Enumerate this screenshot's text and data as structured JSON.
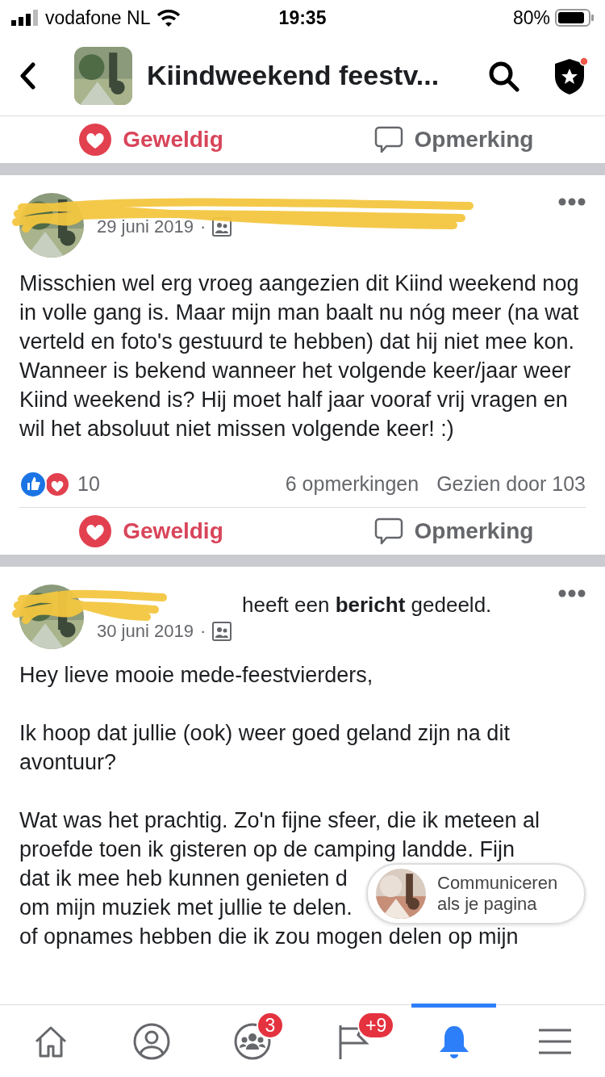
{
  "status_bar": {
    "carrier": "vodafone NL",
    "time": "19:35",
    "battery": "80%"
  },
  "header": {
    "title": "Kiindweekend feestv..."
  },
  "top_actions": [
    {
      "kind": "love",
      "label": "Geweldig"
    },
    {
      "kind": "comment",
      "label": "Opmerking"
    }
  ],
  "posts": [
    {
      "date": "29 juni 2019",
      "separator": "·",
      "paragraphs": [
        "Misschien wel erg vroeg aangezien dit Kiind weekend nog in volle gang is. Maar mijn man baalt nu nóg meer (na wat verteld en foto's gestuurd te hebben) dat hij niet mee kon. Wanneer is bekend wanneer het volgende keer/jaar weer Kiind weekend is? Hij moet half jaar vooraf vrij vragen en wil het absoluut niet missen volgende keer! :)"
      ],
      "reactions": {
        "count": "10",
        "comments": "6 opmerkingen",
        "views": "Gezien door 103"
      },
      "actions": [
        {
          "kind": "love",
          "label": "Geweldig"
        },
        {
          "kind": "comment",
          "label": "Opmerking"
        }
      ]
    },
    {
      "author_line": "heeft een **bericht** gedeeld.",
      "date": "30 juni 2019",
      "separator": "·",
      "paragraphs": [
        "Hey lieve mooie mede-feestvierders,",
        "Ik hoop dat jullie (ook) weer goed geland zijn na dit avontuur?"
      ],
      "partial_lines": [
        "Wat was het prachtig. Zo'n fijne sfeer, die ik meteen al",
        "proefde toen ik gisteren op de camping landde. Fijn",
        "dat ik mee heb kunnen genieten d",
        "om mijn muziek met jullie te delen.",
        "of opnames hebben die ik zou mogen delen op mijn"
      ]
    }
  ],
  "page_chip": {
    "label": "Communiceren als je pagina"
  },
  "nav": [
    {
      "kind": "home",
      "selected": false
    },
    {
      "kind": "profile",
      "selected": false
    },
    {
      "kind": "groups",
      "selected": false,
      "badge": "3"
    },
    {
      "kind": "pages",
      "selected": false,
      "badge": "+9"
    },
    {
      "kind": "bell",
      "selected": true
    },
    {
      "kind": "menu",
      "selected": false
    }
  ]
}
